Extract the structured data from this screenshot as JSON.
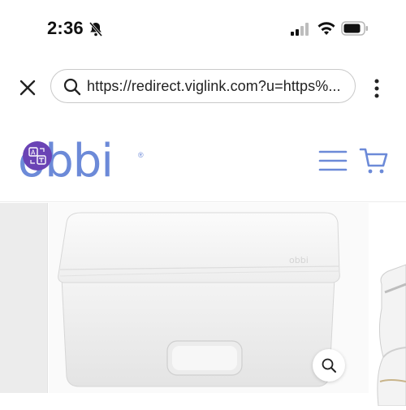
{
  "status_bar": {
    "time": "2:36",
    "icons": [
      "bell-off-icon",
      "signal-icon",
      "wifi-icon",
      "battery-icon"
    ]
  },
  "browser": {
    "url": "https://redirect.viglink.com?u=https%...",
    "icons": [
      "close-icon",
      "search-icon",
      "more-vert-icon"
    ]
  },
  "site": {
    "logo_text": "obbi",
    "logo_mark": "®",
    "brand_color": "#6c8ad8",
    "translate_color": "#6a43b5",
    "icons": [
      "translate-icon",
      "menu-icon",
      "cart-icon",
      "zoom-icon"
    ]
  },
  "product": {
    "embossed_mark": "obbi"
  }
}
